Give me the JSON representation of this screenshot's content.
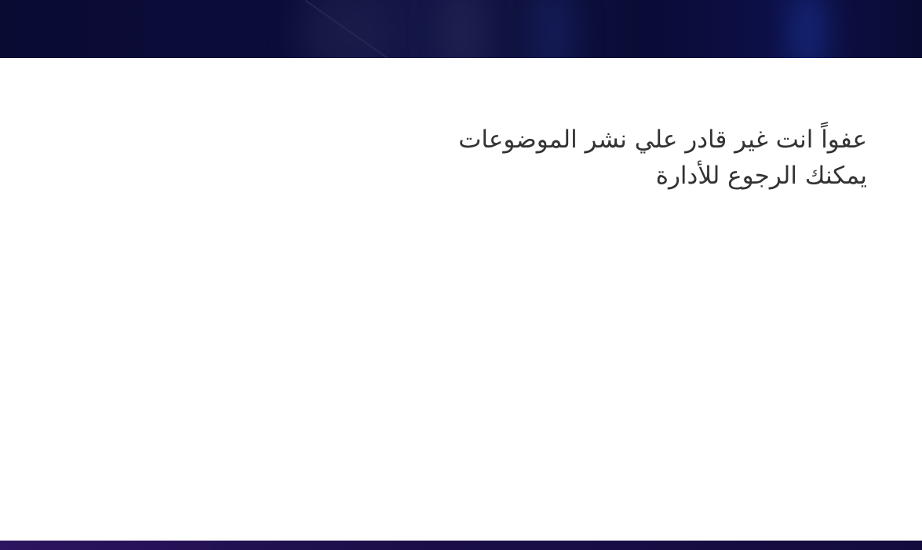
{
  "message": {
    "line1": "عفواً انت غير قادر علي نشر الموضوعات",
    "line2": "يمكنك الرجوع للأدارة"
  },
  "colors": {
    "banner": "#0a0b33",
    "text": "#333333",
    "footer": "#1c0f4a"
  }
}
